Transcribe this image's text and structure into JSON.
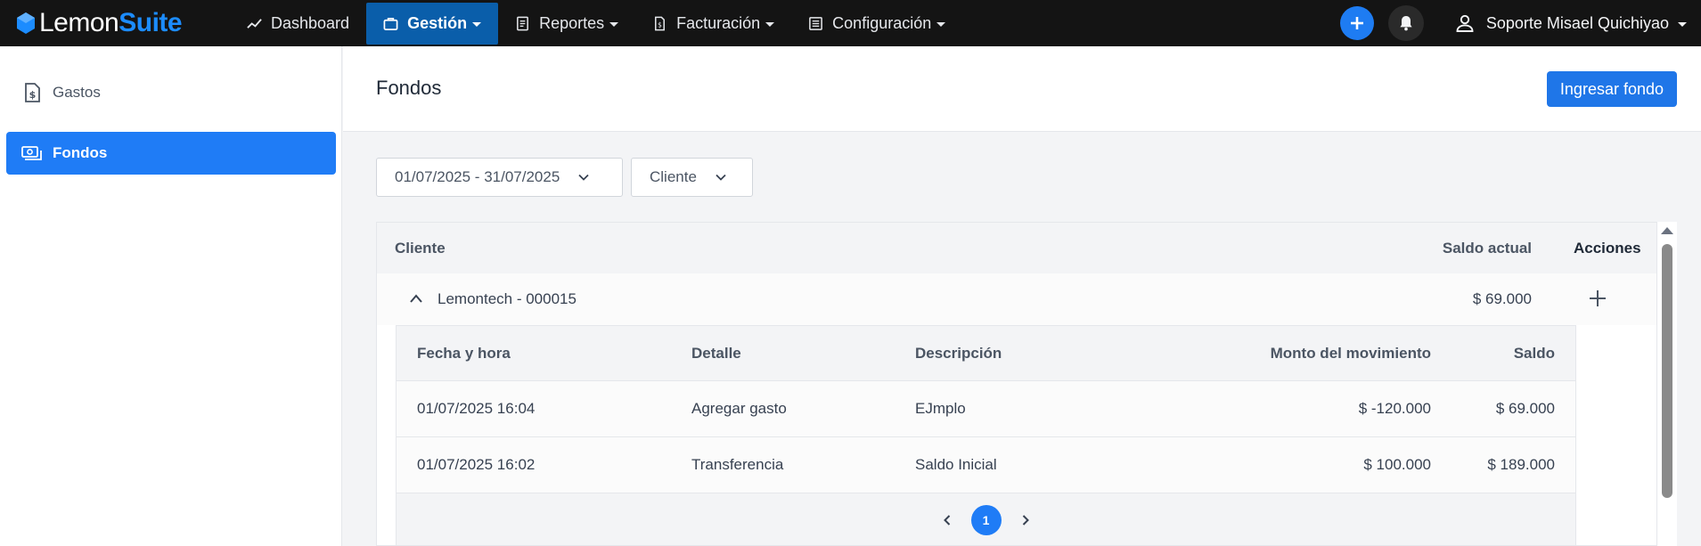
{
  "brand": {
    "part1": "Lemon",
    "part2": "Suite"
  },
  "nav": [
    {
      "label": "Dashboard",
      "icon": "trending-up-icon",
      "dropdown": false,
      "active": false
    },
    {
      "label": "Gestión",
      "icon": "briefcase-icon",
      "dropdown": true,
      "active": true
    },
    {
      "label": "Reportes",
      "icon": "document-icon",
      "dropdown": true,
      "active": false
    },
    {
      "label": "Facturación",
      "icon": "invoice-icon",
      "dropdown": true,
      "active": false
    },
    {
      "label": "Configuración",
      "icon": "list-icon",
      "dropdown": true,
      "active": false
    }
  ],
  "user": {
    "name": "Soporte Misael Quichiyao"
  },
  "sidebar": {
    "items": [
      {
        "label": "Gastos",
        "icon": "receipt-dollar-icon",
        "active": false
      },
      {
        "label": "Fondos",
        "icon": "money-icon",
        "active": true
      }
    ]
  },
  "page": {
    "title": "Fondos",
    "primary_action": "Ingresar fondo"
  },
  "filters": {
    "date_range": "01/07/2025 - 31/07/2025",
    "client": "Cliente"
  },
  "table": {
    "headers": {
      "client": "Cliente",
      "balance": "Saldo actual",
      "actions": "Acciones"
    },
    "group": {
      "name": "Lemontech - 000015",
      "balance": "$ 69.000",
      "expanded": true
    },
    "sub_headers": [
      "Fecha y hora",
      "Detalle",
      "Descripción",
      "Monto del movimiento",
      "Saldo"
    ],
    "rows": [
      {
        "datetime": "01/07/2025 16:04",
        "detail": "Agregar gasto",
        "description": "EJmplo",
        "amount": "$ -120.000",
        "balance": "$ 69.000"
      },
      {
        "datetime": "01/07/2025 16:02",
        "detail": "Transferencia",
        "description": "Saldo Inicial",
        "amount": "$ 100.000",
        "balance": "$ 189.000"
      }
    ],
    "pagination": {
      "current_page": "1"
    }
  },
  "colors": {
    "accent": "#1f7cf6",
    "topbar": "#141414",
    "active_nav": "#0a5eaa",
    "brand_suite": "#1c8cff"
  }
}
